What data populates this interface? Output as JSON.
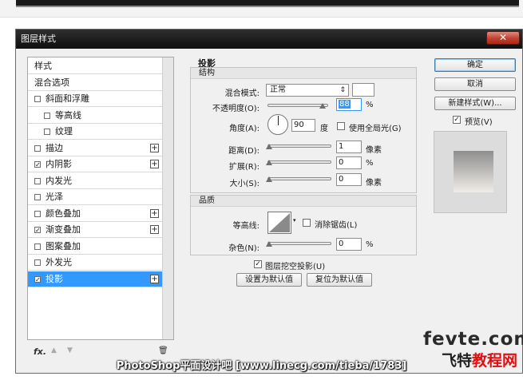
{
  "dialog": {
    "title": "图层样式",
    "close_glyph": "✕"
  },
  "sidebar": {
    "items": [
      {
        "label": "样式",
        "checkbox": false,
        "checked": false,
        "plus": false,
        "indent": 0
      },
      {
        "label": "混合选项",
        "checkbox": false,
        "checked": false,
        "plus": false,
        "indent": 0
      },
      {
        "label": "斜面和浮雕",
        "checkbox": true,
        "checked": false,
        "plus": false,
        "indent": 0
      },
      {
        "label": "等高线",
        "checkbox": true,
        "checked": false,
        "plus": false,
        "indent": 1
      },
      {
        "label": "纹理",
        "checkbox": true,
        "checked": false,
        "plus": false,
        "indent": 1
      },
      {
        "label": "描边",
        "checkbox": true,
        "checked": false,
        "plus": true,
        "indent": 0
      },
      {
        "label": "内阴影",
        "checkbox": true,
        "checked": true,
        "plus": true,
        "indent": 0
      },
      {
        "label": "内发光",
        "checkbox": true,
        "checked": false,
        "plus": false,
        "indent": 0
      },
      {
        "label": "光泽",
        "checkbox": true,
        "checked": false,
        "plus": false,
        "indent": 0
      },
      {
        "label": "颜色叠加",
        "checkbox": true,
        "checked": false,
        "plus": true,
        "indent": 0
      },
      {
        "label": "渐变叠加",
        "checkbox": true,
        "checked": true,
        "plus": true,
        "indent": 0
      },
      {
        "label": "图案叠加",
        "checkbox": true,
        "checked": false,
        "plus": false,
        "indent": 0
      },
      {
        "label": "外发光",
        "checkbox": true,
        "checked": false,
        "plus": false,
        "indent": 0
      },
      {
        "label": "投影",
        "checkbox": true,
        "checked": true,
        "plus": true,
        "indent": 0,
        "selected": true
      }
    ],
    "footer": {
      "fx": "fx.",
      "up": "▲",
      "down": "▼",
      "trash": "🗑"
    }
  },
  "panel": {
    "section_title": "投影",
    "structure": {
      "title": "结构",
      "blend_mode_label": "混合模式:",
      "blend_mode_value": "正常",
      "opacity_label": "不透明度(O):",
      "opacity_value": "88",
      "opacity_unit": "%",
      "angle_label": "角度(A):",
      "angle_value": "90",
      "angle_unit": "度",
      "global_light_label": "使用全局光(G)",
      "distance_label": "距离(D):",
      "distance_value": "1",
      "distance_unit": "像素",
      "spread_label": "扩展(R):",
      "spread_value": "0",
      "spread_unit": "%",
      "size_label": "大小(S):",
      "size_value": "0",
      "size_unit": "像素"
    },
    "quality": {
      "title": "品质",
      "contour_label": "等高线:",
      "antialias_label": "消除锯齿(L)",
      "noise_label": "杂色(N):",
      "noise_value": "0",
      "noise_unit": "%"
    },
    "knockout_label": "图层挖空投影(U)",
    "make_default_label": "设置为默认值",
    "reset_default_label": "复位为默认值"
  },
  "buttons": {
    "ok": "确定",
    "cancel": "取消",
    "new_style": "新建样式(W)...",
    "preview_label": "预览(V)"
  },
  "watermark": {
    "caption": "PhotoShop平面设计吧 [www.linecg.com/tieba/1783]",
    "logo_en": "fevte.com",
    "logo_cn_dark": "飞特",
    "logo_cn_red": "教程网"
  },
  "colors": {
    "selection": "#3399ff",
    "title_bar": "#1b1b1b",
    "close": "#c2412f"
  }
}
